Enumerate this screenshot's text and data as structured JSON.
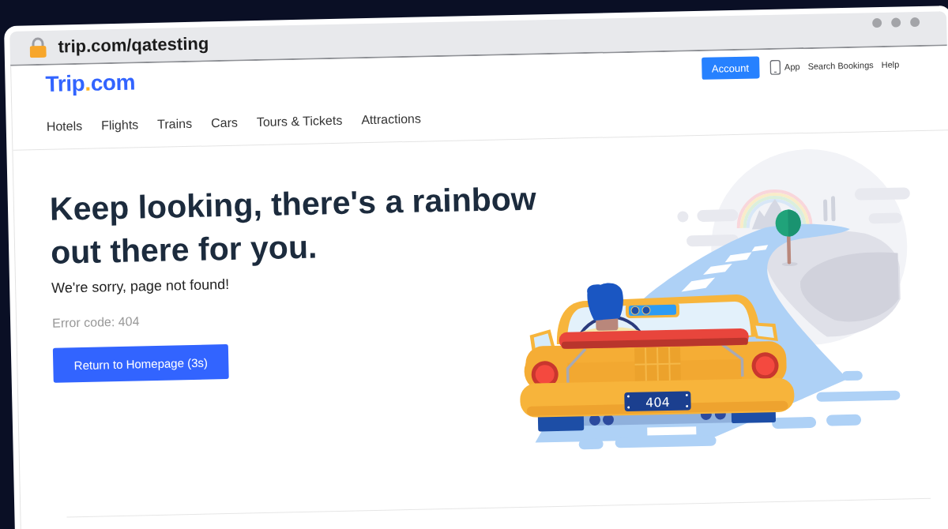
{
  "browser": {
    "url": "trip.com/qatesting",
    "secure": true
  },
  "header": {
    "logo": {
      "brand": "Trip",
      "dot": ".",
      "domain": "com"
    },
    "account_button": "Account",
    "links": [
      {
        "label": "App",
        "kind": "app"
      },
      {
        "label": "Search Bookings",
        "kind": "text"
      },
      {
        "label": "Help",
        "kind": "text"
      }
    ],
    "nav": [
      "Hotels",
      "Flights",
      "Trains",
      "Cars",
      "Tours & Tickets",
      "Attractions"
    ]
  },
  "error": {
    "heading": "Keep looking, there's a rainbow out there for you.",
    "message": "We're sorry, page not found!",
    "code": "Error code: 404",
    "button": "Return to Homepage (3s)"
  },
  "illustration": {
    "plate": "404"
  }
}
